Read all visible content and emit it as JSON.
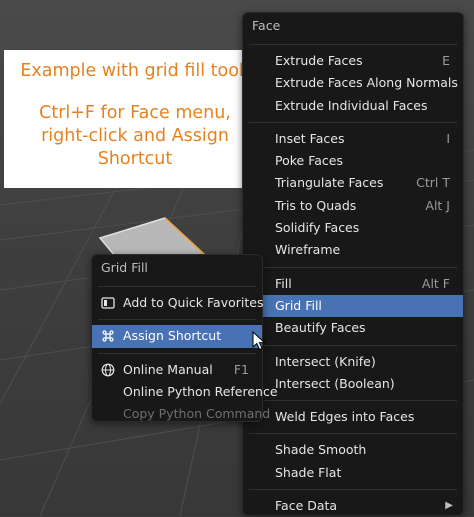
{
  "annotation": {
    "line1": "Example with grid fill tool:",
    "line2": "Ctrl+F for Face menu,",
    "line3": "right-click and Assign",
    "line4": "Shortcut"
  },
  "face_menu": {
    "title": "Face",
    "groups": [
      [
        {
          "label": "Extrude Faces",
          "shortcut": "E"
        },
        {
          "label": "Extrude Faces Along Normals",
          "shortcut": ""
        },
        {
          "label": "Extrude Individual Faces",
          "shortcut": ""
        }
      ],
      [
        {
          "label": "Inset Faces",
          "shortcut": "I"
        },
        {
          "label": "Poke Faces",
          "shortcut": ""
        },
        {
          "label": "Triangulate Faces",
          "shortcut": "Ctrl T"
        },
        {
          "label": "Tris to Quads",
          "shortcut": "Alt J"
        },
        {
          "label": "Solidify Faces",
          "shortcut": ""
        },
        {
          "label": "Wireframe",
          "shortcut": ""
        }
      ],
      [
        {
          "label": "Fill",
          "shortcut": "Alt F"
        },
        {
          "label": "Grid Fill",
          "shortcut": ""
        },
        {
          "label": "Beautify Faces",
          "shortcut": ""
        }
      ],
      [
        {
          "label": "Intersect (Knife)",
          "shortcut": ""
        },
        {
          "label": "Intersect (Boolean)",
          "shortcut": ""
        }
      ],
      [
        {
          "label": "Weld Edges into Faces",
          "shortcut": ""
        }
      ],
      [
        {
          "label": "Shade Smooth",
          "shortcut": ""
        },
        {
          "label": "Shade Flat",
          "shortcut": ""
        }
      ],
      [
        {
          "label": "Face Data",
          "shortcut": ""
        }
      ]
    ]
  },
  "context_menu": {
    "title": "Grid Fill",
    "items": [
      {
        "label": "Add to Quick Favorites",
        "shortcut": "",
        "icon": "quick-favorites-icon"
      },
      {
        "label": "Assign Shortcut",
        "shortcut": "",
        "icon": "keyboard-command-icon"
      },
      {
        "label": "Online Manual",
        "shortcut": "F1",
        "icon": "globe-icon"
      },
      {
        "label": "Online Python Reference",
        "shortcut": "",
        "icon": ""
      },
      {
        "label": "Copy Python Command",
        "shortcut": "",
        "icon": ""
      }
    ]
  },
  "colors": {
    "menu_bg": "#181818",
    "highlight": "#4772b3",
    "annotation_text": "#e7811e",
    "annotation_bg": "#ffffff"
  }
}
